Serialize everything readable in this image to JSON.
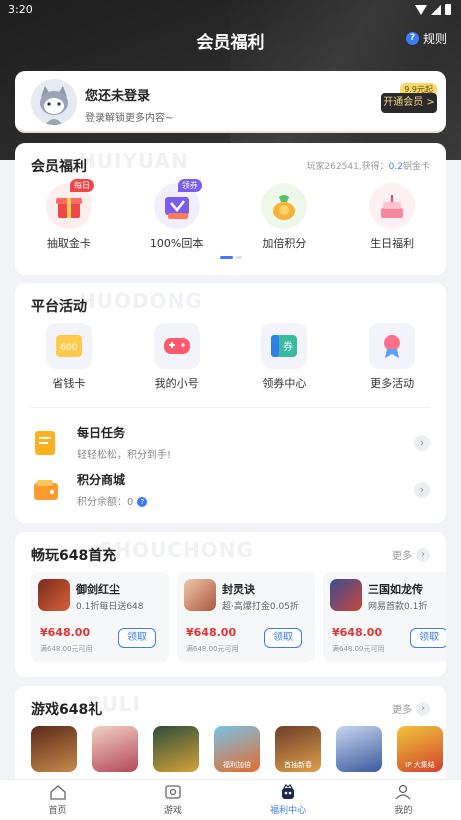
{
  "status_bar": {
    "time": "3:20"
  },
  "header": {
    "title": "会员福利",
    "rules_label": "规则"
  },
  "login": {
    "title": "您还未登录",
    "subtitle": "登录解锁更多内容~",
    "vip_badge": "9.9元起",
    "vip_button": "开通会员 >"
  },
  "members": {
    "title": "会员福利",
    "ghost": "HUIYUAN",
    "meta_prefix": "玩家262541,获得：",
    "meta_value": "0.2",
    "meta_suffix": "钥金卡",
    "items": [
      {
        "label": "抽取金卡",
        "tag": "每日",
        "icon": "gift-box-icon"
      },
      {
        "label": "100%回本",
        "tag": "领券",
        "icon": "ticket-icon"
      },
      {
        "label": "加倍积分",
        "tag": "",
        "icon": "coin-bag-icon"
      },
      {
        "label": "生日福利",
        "tag": "",
        "icon": "cake-icon"
      }
    ]
  },
  "activity": {
    "title": "平台活动",
    "ghost": "HUODONG",
    "items": [
      {
        "label": "省钱卡",
        "icon_text": "600",
        "icon": "save-card-icon"
      },
      {
        "label": "我的小号",
        "icon": "gamepad-icon"
      },
      {
        "label": "领券中心",
        "icon_text": "券",
        "icon": "coupon-icon"
      },
      {
        "label": "更多活动",
        "icon": "ribbon-icon"
      }
    ],
    "tasks": [
      {
        "title": "每日任务",
        "subtitle": "轻轻松松，积分到手!",
        "icon": "task-icon"
      },
      {
        "title": "积分商城",
        "subtitle": "积分余额：0",
        "icon": "wallet-icon"
      }
    ]
  },
  "play648": {
    "title": "畅玩648首充",
    "ghost": "SHOUCHONG",
    "more": "更多",
    "games": [
      {
        "name": "御剑红尘",
        "desc": "0.1折每日送648",
        "price": "¥648.00",
        "note": "满648.00元可用",
        "claim": "领取"
      },
      {
        "name": "封灵诀",
        "desc": "超·高爆打金0.05折",
        "price": "¥648.00",
        "note": "满648.00元可用",
        "claim": "领取"
      },
      {
        "name": "三国如龙传",
        "desc": "网易首款0.1折",
        "price": "¥648.00",
        "note": "满648.00元可用",
        "claim": "领取"
      }
    ]
  },
  "gift648": {
    "title": "游戏648礼",
    "ghost": "FULI",
    "more": "更多",
    "thumbs": [
      {
        "label": ""
      },
      {
        "label": ""
      },
      {
        "label": ""
      },
      {
        "label": "福利加倍"
      },
      {
        "label": "首抽新春"
      },
      {
        "label": ""
      },
      {
        "label": "IP 大集结"
      }
    ]
  },
  "tabbar": {
    "tabs": [
      {
        "label": "首页",
        "icon": "home-icon"
      },
      {
        "label": "游戏",
        "icon": "game-icon"
      },
      {
        "label": "福利中心",
        "icon": "welfare-icon"
      },
      {
        "label": "我的",
        "icon": "profile-icon"
      }
    ]
  },
  "colors": {
    "accent": "#3c7bf5",
    "price": "#e23434",
    "vip_gold": "#f4d68a"
  }
}
